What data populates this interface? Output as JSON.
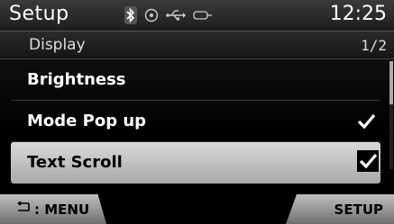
{
  "header": {
    "title": "Setup",
    "time": "12:25",
    "icons": [
      "bluetooth-icon",
      "disc-icon",
      "usb-icon",
      "aux-icon"
    ]
  },
  "subheader": {
    "section": "Display",
    "page": "1/2"
  },
  "list": {
    "items": [
      {
        "label": "Brightness",
        "checked": false,
        "selected": false
      },
      {
        "label": "Mode Pop up",
        "checked": true,
        "selected": false
      },
      {
        "label": "Text Scroll",
        "checked": true,
        "selected": true
      }
    ]
  },
  "footer": {
    "left_label": ": MENU",
    "right_label": "SETUP"
  }
}
